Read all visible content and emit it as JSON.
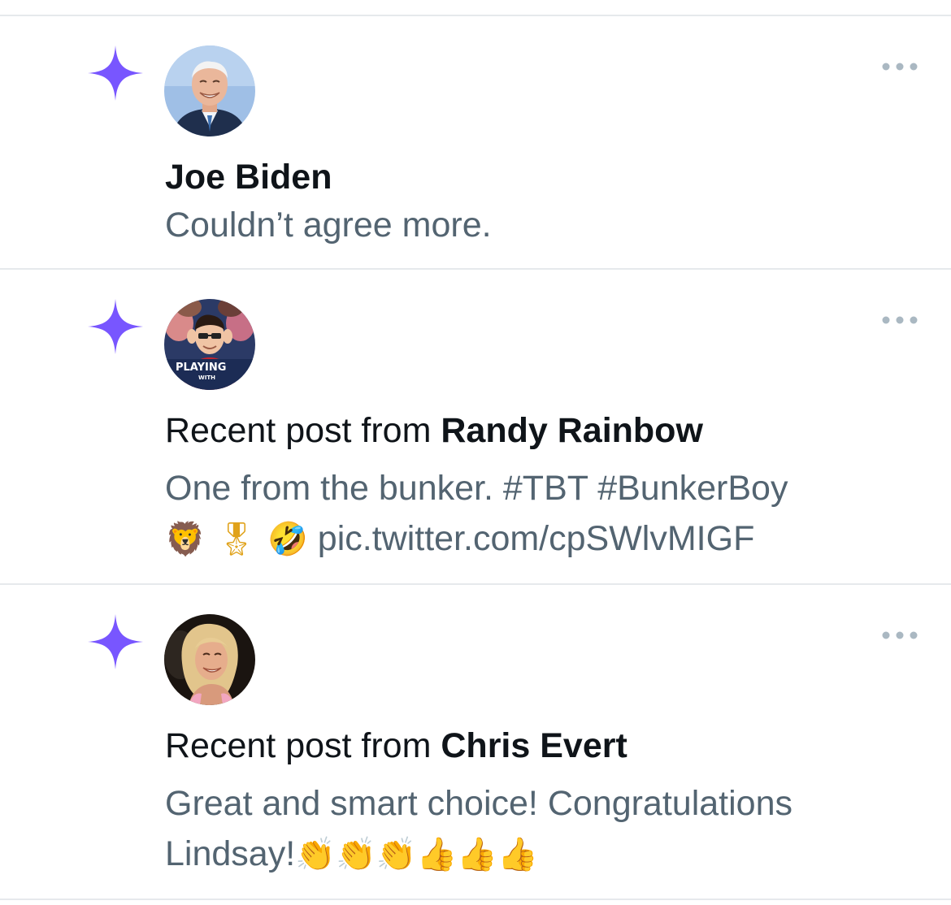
{
  "notifications": [
    {
      "title_prefix": "",
      "name": "Joe Biden",
      "text": "Couldn’t agree more.",
      "more_icon": "more-horizontal-icon",
      "badge_icon": "sparkle-icon",
      "accent": "#7856ff"
    },
    {
      "title_prefix": "Recent post from",
      "name": "Randy Rainbow",
      "text_line1": "One from the bunker. #TBT #BunkerBoy",
      "emojis": "🦁 🎖 🤣",
      "link": "pic.twitter.com/cpSWlvMIGF",
      "avatar_banner": "PLAYING",
      "avatar_banner_sub": "WITH",
      "more_icon": "more-horizontal-icon",
      "badge_icon": "sparkle-icon"
    },
    {
      "title_prefix": "Recent post from",
      "name": "Chris Evert",
      "text_line1": "Great and smart choice! Congratulations",
      "text_line2_prefix": "Lindsay!",
      "emojis": "👏👏👏👍👍👍",
      "more_icon": "more-horizontal-icon",
      "badge_icon": "sparkle-icon"
    }
  ],
  "colors": {
    "sparkle": "#7856ff",
    "secondary_text": "#536471",
    "primary_text": "#0f1419",
    "divider": "#e6e9ec"
  }
}
